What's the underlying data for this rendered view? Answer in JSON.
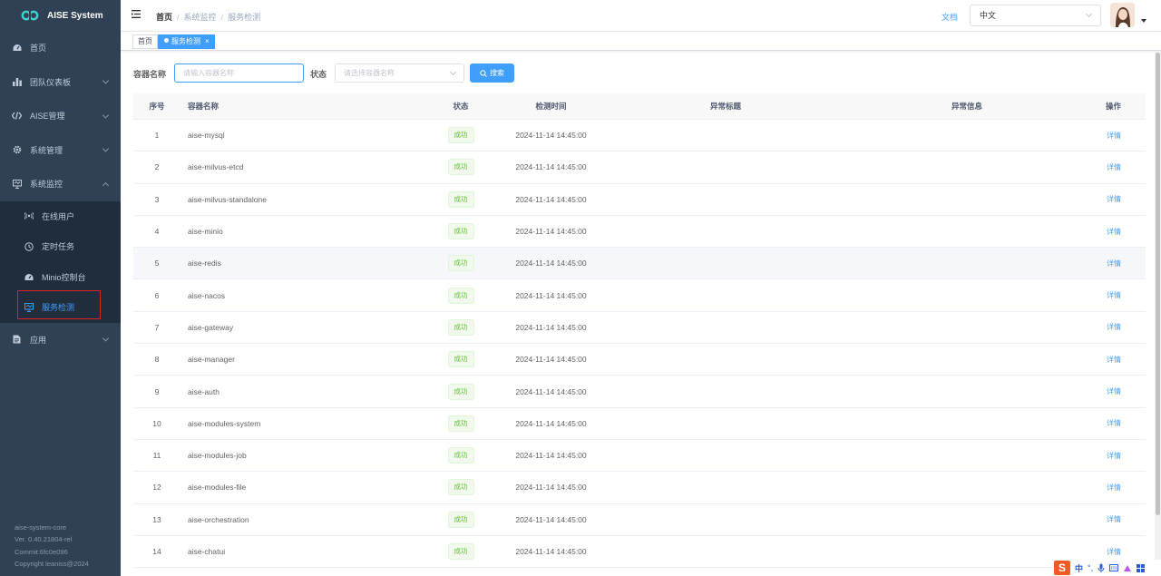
{
  "app": {
    "title": "AISE System"
  },
  "sidebar": {
    "items": [
      {
        "label": "首页",
        "icon": "dashboard-icon"
      },
      {
        "label": "团队仪表板",
        "icon": "bar-chart-icon"
      },
      {
        "label": "AISE管理",
        "icon": "code-icon"
      },
      {
        "label": "系统管理",
        "icon": "gear-icon"
      },
      {
        "label": "系统监控",
        "icon": "monitor-icon"
      },
      {
        "label": "应用",
        "icon": "document-icon"
      }
    ],
    "monitor_sub": [
      {
        "label": "在线用户",
        "icon": "online-icon"
      },
      {
        "label": "定时任务",
        "icon": "clock-icon"
      },
      {
        "label": "Minio控制台",
        "icon": "dashboard-icon"
      },
      {
        "label": "服务检测",
        "icon": "monitor-icon"
      }
    ],
    "footer": {
      "name": "aise-system-core",
      "version": "Ver. 0.40.21804-rel",
      "commit": "Commit:6fc0e096",
      "copyright": "Copyright leaniss@2024"
    }
  },
  "navbar": {
    "breadcrumb": [
      "首页",
      "系统监控",
      "服务检测"
    ],
    "doc_link": "文档",
    "language": "中文"
  },
  "tags": {
    "home": "首页",
    "current": "服务检测",
    "close": "×"
  },
  "search": {
    "name_label": "容器名称",
    "name_placeholder": "请输入容器名称",
    "status_label": "状态",
    "status_placeholder": "请选择容器名称",
    "button": "搜索"
  },
  "table": {
    "headers": [
      "序号",
      "容器名称",
      "状态",
      "检测时间",
      "异常标题",
      "异常信息",
      "操作"
    ],
    "rows": [
      {
        "idx": "1",
        "name": "aise-mysql",
        "status": "成功",
        "time": "2024-11-14 14:45:00",
        "op": "详情"
      },
      {
        "idx": "2",
        "name": "aise-milvus-etcd",
        "status": "成功",
        "time": "2024-11-14 14:45:00",
        "op": "详情"
      },
      {
        "idx": "3",
        "name": "aise-milvus-standalone",
        "status": "成功",
        "time": "2024-11-14 14:45:00",
        "op": "详情"
      },
      {
        "idx": "4",
        "name": "aise-minio",
        "status": "成功",
        "time": "2024-11-14 14:45:00",
        "op": "详情"
      },
      {
        "idx": "5",
        "name": "aise-redis",
        "status": "成功",
        "time": "2024-11-14 14:45:00",
        "op": "详情"
      },
      {
        "idx": "6",
        "name": "aise-nacos",
        "status": "成功",
        "time": "2024-11-14 14:45:00",
        "op": "详情"
      },
      {
        "idx": "7",
        "name": "aise-gateway",
        "status": "成功",
        "time": "2024-11-14 14:45:00",
        "op": "详情"
      },
      {
        "idx": "8",
        "name": "aise-manager",
        "status": "成功",
        "time": "2024-11-14 14:45:00",
        "op": "详情"
      },
      {
        "idx": "9",
        "name": "aise-auth",
        "status": "成功",
        "time": "2024-11-14 14:45:00",
        "op": "详情"
      },
      {
        "idx": "10",
        "name": "aise-modules-system",
        "status": "成功",
        "time": "2024-11-14 14:45:00",
        "op": "详情"
      },
      {
        "idx": "11",
        "name": "aise-modules-job",
        "status": "成功",
        "time": "2024-11-14 14:45:00",
        "op": "详情"
      },
      {
        "idx": "12",
        "name": "aise-modules-file",
        "status": "成功",
        "time": "2024-11-14 14:45:00",
        "op": "详情"
      },
      {
        "idx": "13",
        "name": "aise-orchestration",
        "status": "成功",
        "time": "2024-11-14 14:45:00",
        "op": "详情"
      },
      {
        "idx": "14",
        "name": "aise-chatui",
        "status": "成功",
        "time": "2024-11-14 14:45:00",
        "op": "详情"
      }
    ]
  },
  "ime": {
    "logo": "S",
    "mode": "中"
  },
  "colors": {
    "sidebar_bg": "#304156",
    "submenu_bg": "#1f2d3d",
    "accent": "#409eff",
    "success": "#67c23a",
    "highlight_border": "#e02020"
  }
}
